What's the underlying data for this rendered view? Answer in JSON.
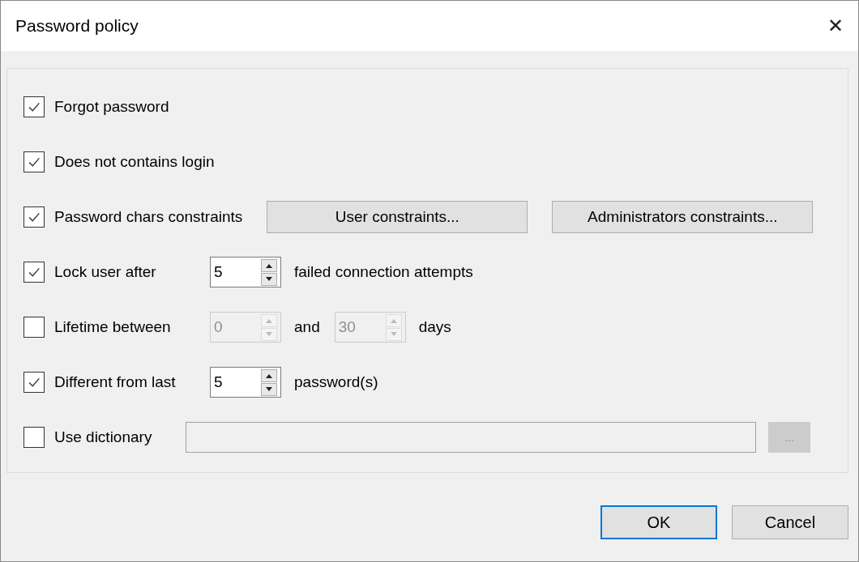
{
  "window": {
    "title": "Password policy",
    "close": "✕"
  },
  "rows": [
    {
      "label": "Forgot password",
      "checked": true,
      "parts": []
    },
    {
      "label": "Does not contains login",
      "checked": true,
      "parts": []
    },
    {
      "label": "Password chars constraints",
      "checked": true,
      "parts": [
        {
          "kind": "button",
          "label": "User constraints..."
        },
        {
          "kind": "button",
          "label": "Administrators constraints..."
        }
      ]
    },
    {
      "label": "Lock user after",
      "checked": true,
      "parts": [
        {
          "kind": "spinner",
          "value": "5",
          "disabled": false
        },
        {
          "kind": "text",
          "text": "failed connection attempts"
        }
      ]
    },
    {
      "label": "Lifetime between",
      "checked": false,
      "parts": [
        {
          "kind": "spinner",
          "value": "0",
          "disabled": true
        },
        {
          "kind": "text",
          "text": "and"
        },
        {
          "kind": "spinner",
          "value": "30",
          "disabled": true
        },
        {
          "kind": "text",
          "text": "days"
        }
      ]
    },
    {
      "label": "Different from last",
      "checked": true,
      "parts": [
        {
          "kind": "spinner",
          "value": "5",
          "disabled": false
        },
        {
          "kind": "text",
          "text": "password(s)"
        }
      ]
    },
    {
      "label": "Use dictionary",
      "checked": false,
      "parts": [
        {
          "kind": "field",
          "disabled": true
        },
        {
          "kind": "browse",
          "label": "...",
          "disabled": true
        }
      ]
    }
  ],
  "buttons": [
    {
      "label": "OK",
      "default": true
    },
    {
      "label": "Cancel",
      "default": false
    }
  ]
}
